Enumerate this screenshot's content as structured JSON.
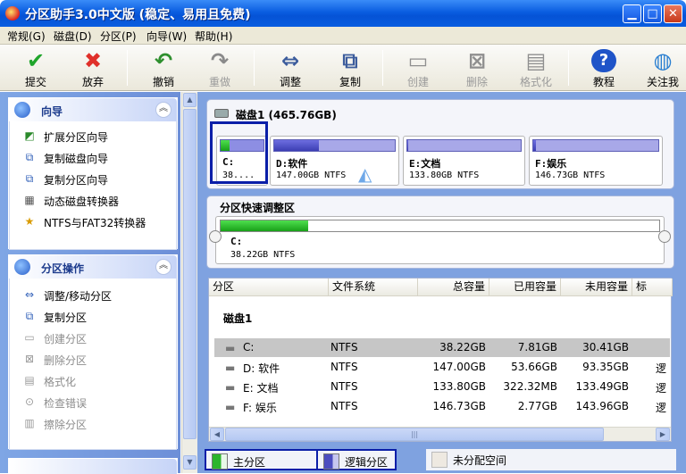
{
  "window": {
    "title": "分区助手3.0中文版 (稳定、易用且免费)"
  },
  "menu": [
    "常规(G)",
    "磁盘(D)",
    "分区(P)",
    "向导(W)",
    "帮助(H)"
  ],
  "toolbar": {
    "submit": "提交",
    "discard": "放弃",
    "undo": "撤销",
    "redo": "重做",
    "resize": "调整",
    "copy": "复制",
    "create": "创建",
    "delete": "删除",
    "format": "格式化",
    "tutorial": "教程",
    "follow": "关注我"
  },
  "wizard_panel": {
    "title": "向导",
    "items": [
      "扩展分区向导",
      "复制磁盘向导",
      "复制分区向导",
      "动态磁盘转换器",
      "NTFS与FAT32转换器"
    ]
  },
  "ops_panel": {
    "title": "分区操作",
    "items": [
      "调整/移动分区",
      "复制分区",
      "创建分区",
      "删除分区",
      "格式化",
      "检查错误",
      "擦除分区"
    ]
  },
  "disk_card": {
    "title": "磁盘1  (465.76GB)",
    "partitions": [
      {
        "name": "C:",
        "size": "38....",
        "kind": "primary",
        "used_fraction": 0.2
      },
      {
        "name": "D:软件",
        "size": "147.00GB NTFS",
        "kind": "logical",
        "used_fraction": 0.37
      },
      {
        "name": "E:文档",
        "size": "133.80GB NTFS",
        "kind": "logical",
        "used_fraction": 0.01
      },
      {
        "name": "F:娱乐",
        "size": "146.73GB NTFS",
        "kind": "logical",
        "used_fraction": 0.02
      }
    ]
  },
  "quick_resize": {
    "title": "分区快速调整区",
    "name": "C:",
    "size": "38.22GB NTFS",
    "used_fraction": 0.2
  },
  "list": {
    "headers": [
      "分区",
      "文件系统",
      "总容量",
      "已用容量",
      "未用容量",
      "标"
    ],
    "disk_label": "磁盘1",
    "rows": [
      {
        "partition": "C:",
        "fs": "NTFS",
        "total": "38.22GB",
        "used": "7.81GB",
        "free": "30.41GB",
        "flag": ""
      },
      {
        "partition": "D: 软件",
        "fs": "NTFS",
        "total": "147.00GB",
        "used": "53.66GB",
        "free": "93.35GB",
        "flag": "逻"
      },
      {
        "partition": "E: 文档",
        "fs": "NTFS",
        "total": "133.80GB",
        "used": "322.32MB",
        "free": "133.49GB",
        "flag": "逻"
      },
      {
        "partition": "F: 娱乐",
        "fs": "NTFS",
        "total": "146.73GB",
        "used": "2.77GB",
        "free": "143.96GB",
        "flag": "逻"
      }
    ]
  },
  "legend": {
    "primary": "主分区",
    "logical": "逻辑分区",
    "unallocated": "未分配空间"
  },
  "colors": {
    "primary": "#2cb52c",
    "logical": "#4b4dbf",
    "selection": "#0a1ea8"
  }
}
